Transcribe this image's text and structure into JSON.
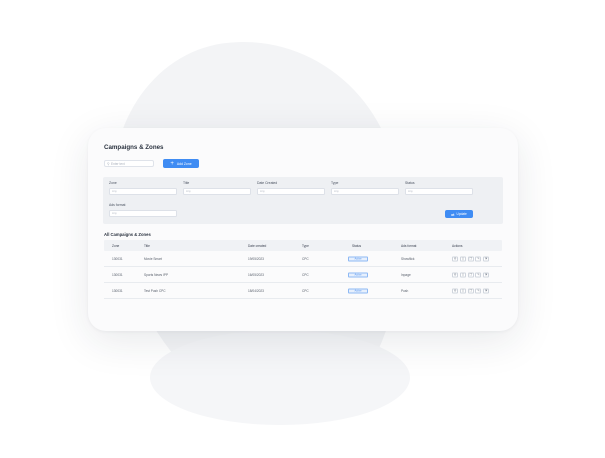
{
  "page": {
    "title": "Campaigns & Zones"
  },
  "toolbar": {
    "search_placeholder": "Enter text",
    "add_zone_label": "Add Zone"
  },
  "filters": {
    "zone": {
      "label": "Zone",
      "placeholder": "Any"
    },
    "title": {
      "label": "Title",
      "placeholder": "Any"
    },
    "date_created": {
      "label": "Date Created",
      "placeholder": "Any"
    },
    "type": {
      "label": "Type",
      "placeholder": "Any"
    },
    "status": {
      "label": "Status",
      "placeholder": "Any"
    },
    "ads_format": {
      "label": "Ads format",
      "placeholder": "Any"
    },
    "update_label": "Update"
  },
  "table": {
    "title": "All Campaigns & Zones",
    "columns": [
      "Zone",
      "Title",
      "Date created",
      "Type",
      "Status",
      "Ads format",
      "Actions"
    ],
    "rows": [
      {
        "zone": "130031",
        "title": "Movie Smart",
        "date": "19/05/2023",
        "type": "CPC",
        "status": "Active",
        "format": "Showflick"
      },
      {
        "zone": "130031",
        "title": "Sports News IPP",
        "date": "16/05/2023",
        "type": "CPC",
        "status": "Active",
        "format": "Inpage"
      },
      {
        "zone": "130031",
        "title": "Test Push CPC",
        "date": "18/04/2023",
        "type": "CPC",
        "status": "Active",
        "format": "Push"
      }
    ],
    "action_icons": [
      "settings-icon",
      "chart-icon",
      "copy-icon",
      "edit-icon",
      "delete-icon"
    ]
  },
  "colors": {
    "accent": "#3f8cf3",
    "badge_bg": "#e7f0fd",
    "filter_bg": "#eef0f3"
  }
}
